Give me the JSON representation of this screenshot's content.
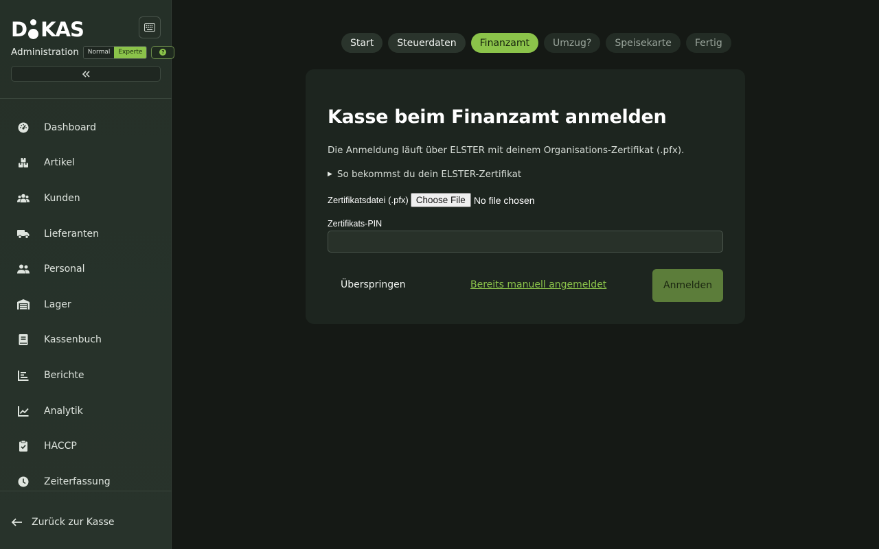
{
  "brand": {
    "logo_text_left": "D",
    "logo_text_right": "KAS"
  },
  "sidebar": {
    "admin_label": "Administration",
    "mode_normal": "Normal",
    "mode_expert": "Experte",
    "collapse_icon": "double-chevron-left-icon",
    "items": [
      {
        "label": "Dashboard",
        "icon": "gauge-icon"
      },
      {
        "label": "Artikel",
        "icon": "boxes-icon"
      },
      {
        "label": "Kunden",
        "icon": "users-icon"
      },
      {
        "label": "Lieferanten",
        "icon": "truck-icon"
      },
      {
        "label": "Personal",
        "icon": "user-group-icon"
      },
      {
        "label": "Lager",
        "icon": "warehouse-icon"
      },
      {
        "label": "Kassenbuch",
        "icon": "book-icon"
      },
      {
        "label": "Berichte",
        "icon": "bar-chart-icon"
      },
      {
        "label": "Analytik",
        "icon": "line-chart-icon"
      },
      {
        "label": "HACCP",
        "icon": "clipboard-check-icon"
      },
      {
        "label": "Zeiterfassung",
        "icon": "clock-icon"
      }
    ],
    "back_label": "Zurück zur Kasse"
  },
  "stepper": {
    "steps": [
      {
        "label": "Start",
        "state": "done"
      },
      {
        "label": "Steuerdaten",
        "state": "done"
      },
      {
        "label": "Finanzamt",
        "state": "active"
      },
      {
        "label": "Umzug?",
        "state": "pending"
      },
      {
        "label": "Speisekarte",
        "state": "pending"
      },
      {
        "label": "Fertig",
        "state": "pending"
      }
    ]
  },
  "card": {
    "title": "Kasse beim Finanzamt anmelden",
    "description": "Die Anmeldung läuft über ELSTER mit deinem Organisations-Zertifikat (.pfx).",
    "details_summary": "So bekommst du dein ELSTER-Zertifikat",
    "file_label": "Zertifikatsdatei (.pfx)",
    "file_button": "Choose File",
    "file_status": "No file chosen",
    "pin_label": "Zertifikats-PIN",
    "pin_value": "",
    "skip_label": "Überspringen",
    "manual_link": "Bereits manuell angemeldet",
    "submit_label": "Anmelden"
  },
  "colors": {
    "accent": "#8bc34a",
    "background": "#151915",
    "sidebar": "#263129",
    "card": "#1d251f"
  }
}
